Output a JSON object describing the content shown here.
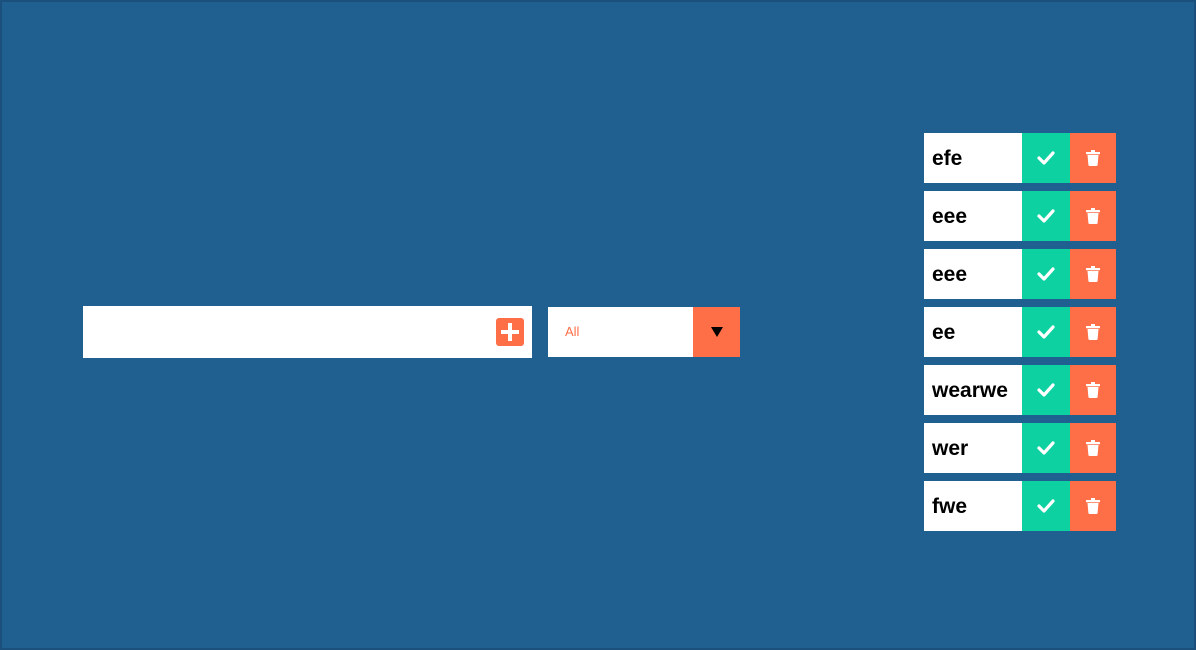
{
  "colors": {
    "background": "#1f6091",
    "accent": "#ff6f47",
    "complete": "#0ed1a2",
    "white": "#ffffff",
    "text": "#000000"
  },
  "form": {
    "input_value": "",
    "input_placeholder": "",
    "add_icon": "plus-square-icon",
    "filter": {
      "selected": "All",
      "arrow_icon": "caret-down-icon"
    }
  },
  "todos": [
    {
      "text": "efe"
    },
    {
      "text": "eee"
    },
    {
      "text": "eee"
    },
    {
      "text": "ee"
    },
    {
      "text": "wearwe"
    },
    {
      "text": "wer"
    },
    {
      "text": "fwe"
    }
  ],
  "item_icons": {
    "complete": "check-icon",
    "delete": "trash-icon"
  }
}
